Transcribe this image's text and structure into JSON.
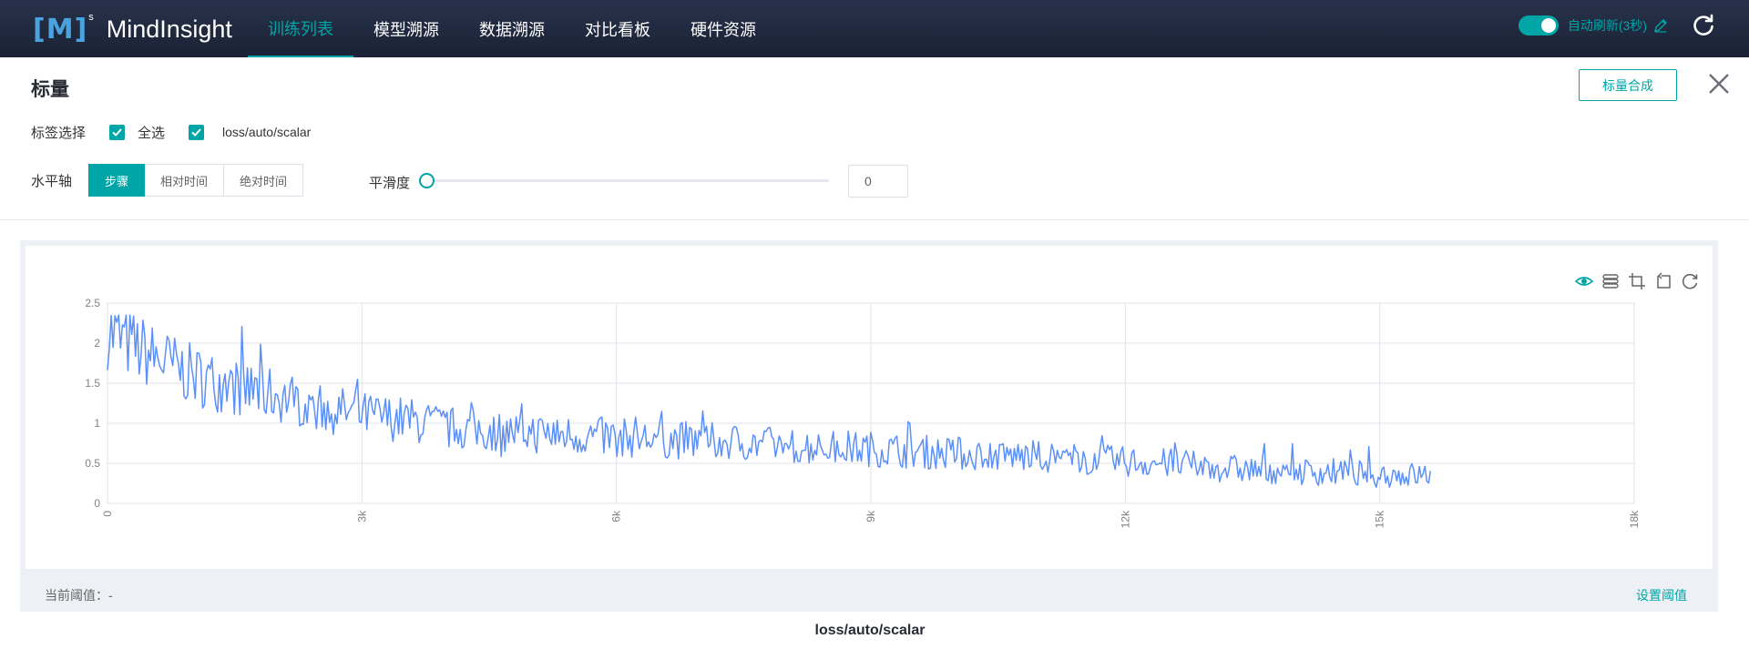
{
  "app": {
    "logo": "[M]",
    "logo_sup": "s",
    "name": "MindInsight"
  },
  "nav": [
    {
      "label": "训练列表",
      "active": true
    },
    {
      "label": "模型溯源",
      "active": false
    },
    {
      "label": "数据溯源",
      "active": false
    },
    {
      "label": "对比看板",
      "active": false
    },
    {
      "label": "硬件资源",
      "active": false
    }
  ],
  "auto_refresh": {
    "label": "自动刷新(3秒)",
    "enabled": true
  },
  "page": {
    "title": "标量",
    "compose_button": "标量合成"
  },
  "tag_select": {
    "label": "标签选择",
    "select_all": "全选",
    "tags": [
      "loss/auto/scalar"
    ]
  },
  "x_axis": {
    "label": "水平轴",
    "options": [
      "步骤",
      "相对时间",
      "绝对时间"
    ],
    "selected": "步骤"
  },
  "smoothing": {
    "label": "平滑度",
    "value": "0"
  },
  "threshold": {
    "label": "当前阈值：-",
    "set_link": "设置阈值"
  },
  "icons": [
    "eye-icon",
    "legend-icon",
    "crop-icon",
    "restore-icon",
    "reset-icon"
  ],
  "colors": {
    "accent": "#00a5a7",
    "series": "#5b8ff9"
  },
  "chart_data": {
    "type": "line",
    "title": "loss/auto/scalar",
    "x_ticks": [
      "0",
      "3k",
      "6k",
      "9k",
      "12k",
      "15k",
      "18k"
    ],
    "y_ticks": [
      "0",
      "0.5",
      "1",
      "1.5",
      "2",
      "2.5"
    ],
    "xlim": [
      0,
      18000
    ],
    "ylim": [
      0,
      2.5
    ],
    "grid": true,
    "series": [
      {
        "x": [
          0,
          500,
          1000,
          1500,
          2000,
          2500,
          3000,
          3500,
          4000,
          4500,
          5000,
          5500,
          6000,
          6500,
          7000,
          7500,
          8000,
          8500,
          9000,
          9500,
          10000,
          10500,
          11000,
          11500,
          12000,
          12500,
          13000,
          13500,
          14000,
          14500,
          15000,
          15600
        ],
        "y": [
          2.15,
          1.85,
          1.6,
          1.45,
          1.35,
          1.2,
          1.1,
          1.05,
          0.95,
          0.9,
          0.88,
          0.85,
          0.82,
          0.8,
          0.78,
          0.76,
          0.72,
          0.7,
          0.68,
          0.65,
          0.62,
          0.6,
          0.58,
          0.55,
          0.52,
          0.5,
          0.45,
          0.42,
          0.4,
          0.38,
          0.36,
          0.35
        ]
      }
    ]
  }
}
